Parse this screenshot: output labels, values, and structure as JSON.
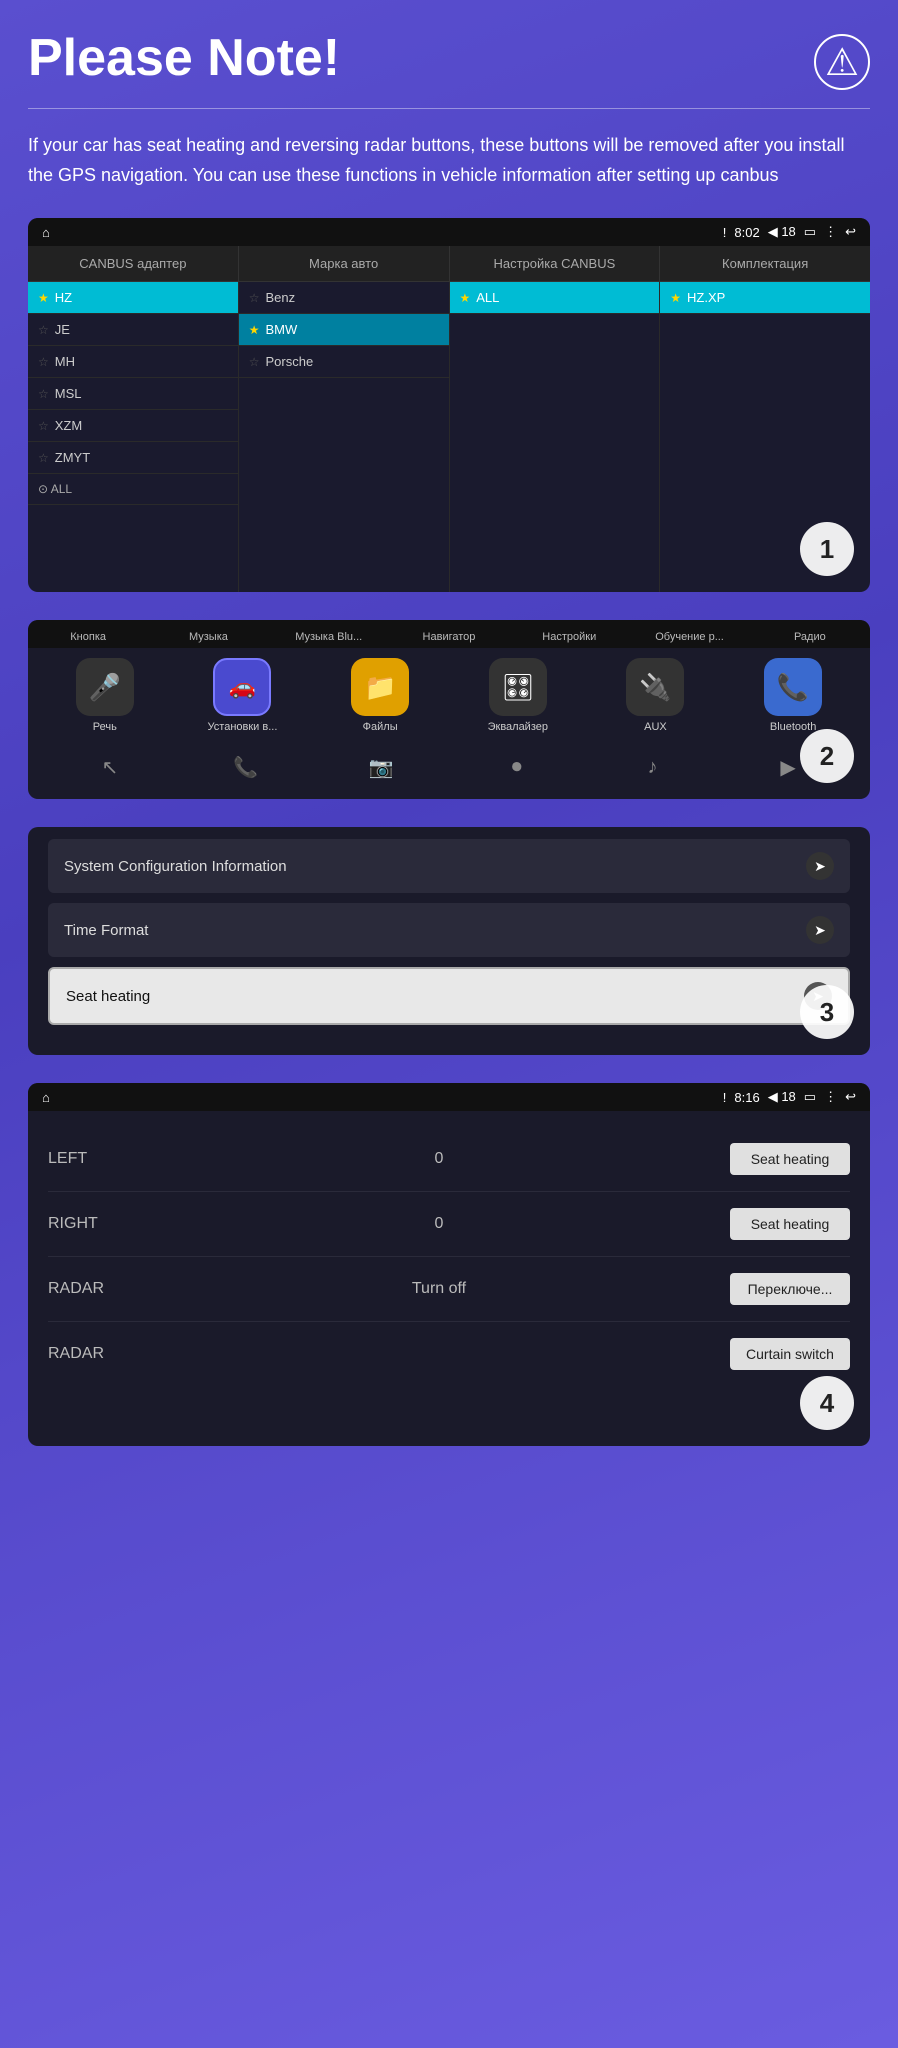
{
  "page": {
    "title": "Please Note!",
    "warning_icon": "⚠",
    "note_text": "If your car has seat heating and reversing radar buttons, these buttons will be removed after you install the GPS navigation. You can use these functions in vehicle information after setting up canbus"
  },
  "panel1": {
    "status_bar": {
      "home": "⌂",
      "alert": "!",
      "time": "8:02",
      "volume": "◀ 18",
      "battery": "▭",
      "menu": "⋮",
      "back": "↩"
    },
    "tabs": [
      "CANBUS адаптер",
      "Марка авто",
      "Настройка CANBUS",
      "Комплектация"
    ],
    "col1": {
      "items": [
        {
          "label": "HZ",
          "star": "gold",
          "active": true
        },
        {
          "label": "JE",
          "star": "gray"
        },
        {
          "label": "MH",
          "star": "gray"
        },
        {
          "label": "MSL",
          "star": "gray"
        },
        {
          "label": "XZM",
          "star": "gray"
        },
        {
          "label": "ZMYT",
          "star": "gray"
        },
        {
          "label": "ALL",
          "icon": "circle"
        }
      ]
    },
    "col2": {
      "items": [
        {
          "label": "Benz",
          "star": "gray"
        },
        {
          "label": "BMW",
          "star": "gold",
          "highlighted": true
        },
        {
          "label": "Porsche",
          "star": "gray"
        }
      ]
    },
    "col3": {
      "items": [
        {
          "label": "ALL",
          "star": "gold",
          "active": true
        }
      ]
    },
    "col4": {
      "items": [
        {
          "label": "HZ.XP",
          "star": "gold",
          "active": true
        }
      ]
    },
    "badge": "1"
  },
  "panel2": {
    "tabs": [
      "Кнопка",
      "Музыка",
      "Музыка Blu...",
      "Навигатор",
      "Настройки",
      "Обучение р...",
      "Радио"
    ],
    "apps": [
      {
        "label": "Речь",
        "icon": "🎤",
        "style": "mic"
      },
      {
        "label": "Установки в...",
        "icon": "🚗",
        "style": "settings",
        "active": true
      },
      {
        "label": "Файлы",
        "icon": "📁",
        "style": "files"
      },
      {
        "label": "Эквалайзер",
        "icon": "🎛",
        "style": "eq"
      },
      {
        "label": "AUX",
        "icon": "🔌",
        "style": "aux"
      },
      {
        "label": "Bluetooth",
        "icon": "🔵",
        "style": "bluetooth"
      }
    ],
    "nav_icons": [
      "↖",
      "📞",
      "📷",
      "⏺",
      "♪",
      "▶"
    ],
    "badge": "2"
  },
  "panel3": {
    "rows": [
      {
        "label": "System Configuration Information",
        "arrow": "➤",
        "highlighted": false
      },
      {
        "label": "Time Format",
        "arrow": "➤",
        "highlighted": false
      },
      {
        "label": "Seat heating",
        "arrow": "➤",
        "highlighted": true
      }
    ],
    "badge": "3"
  },
  "panel4": {
    "status_bar": {
      "home": "⌂",
      "alert": "!",
      "time": "8:16",
      "volume": "◀ 18",
      "battery": "▭",
      "menu": "⋮",
      "back": "↩"
    },
    "rows": [
      {
        "label": "LEFT",
        "value": "0",
        "btn": "Seat heating"
      },
      {
        "label": "RIGHT",
        "value": "0",
        "btn": "Seat heating"
      },
      {
        "label": "RADAR",
        "value": "Turn off",
        "btn": "Переключе..."
      },
      {
        "label": "RADAR",
        "value": "",
        "btn": "Curtain switch"
      }
    ],
    "badge": "4"
  }
}
